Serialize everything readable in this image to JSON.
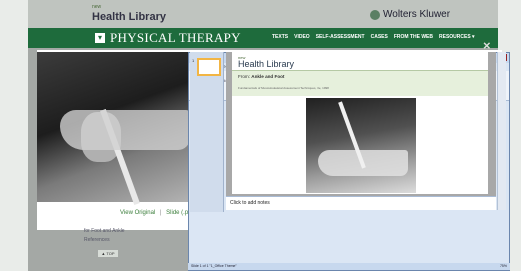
{
  "site": {
    "brand_small": "new",
    "brand_main": "Health Library",
    "publisher": "Wolters Kluwer",
    "section_title": "PHYSICAL THERAPY",
    "nav": [
      "TEXTS",
      "VIDEO",
      "SELF-ASSESSMENT",
      "CASES",
      "FROM THE WEB",
      "RESOURCES ▾"
    ]
  },
  "modal": {
    "close_glyph": "×",
    "link_original": "View Original",
    "separator": "|",
    "link_slide": "Slide (.ppt)"
  },
  "behind": {
    "item1": "for Foot and Ankle",
    "item2": "References",
    "top_button": "▲ TOP"
  },
  "ppt": {
    "title": "Figure [Compatibility Mode] - Microsoft PowerPoint",
    "tabs": [
      "File",
      "Home",
      "Insert",
      "Design",
      "Transitions",
      "Animations",
      "Slide Show",
      "Review",
      "View",
      "Acrobat"
    ],
    "groups": [
      "Clipboard",
      "Slides",
      "Font",
      "Paragraph",
      "Drawing",
      "Editing"
    ],
    "thumb_number": "1",
    "slide": {
      "logo_small": "new",
      "logo": "Health Library",
      "from_label": "From:",
      "from_value": "Ankle and Foot",
      "source": "Fundamentals of Musculoskeletal Assessment Techniques, 3e, 1998"
    },
    "notes_placeholder": "Click to add notes",
    "status": "Slide 1 of 1   \"1_Office Theme\"",
    "zoom": "75%"
  }
}
